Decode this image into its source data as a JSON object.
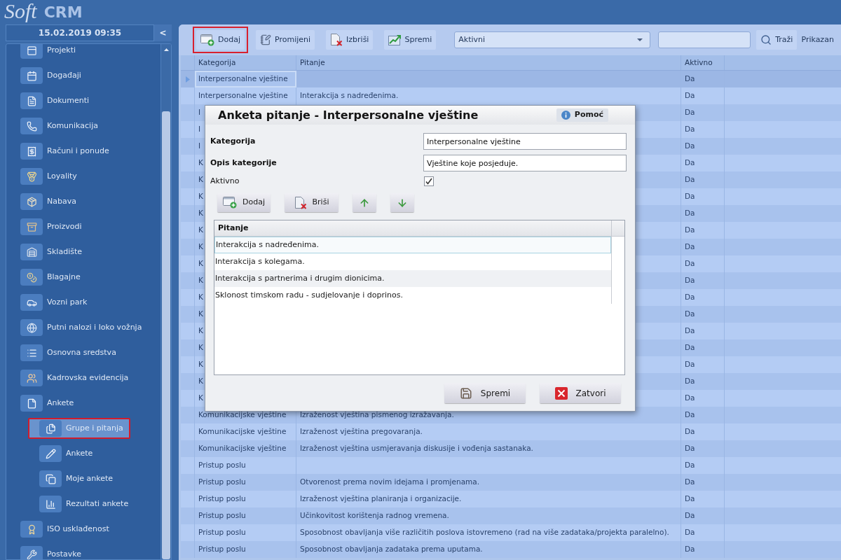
{
  "logo": {
    "script": "Soft",
    "wordmark": "CRM"
  },
  "sidebar": {
    "datetime": "15.02.2019 09:35",
    "collapse_button": "<",
    "items": [
      {
        "label": "Projekti",
        "selected": false,
        "highlighted": false
      },
      {
        "label": "Događaji",
        "selected": false,
        "highlighted": false
      },
      {
        "label": "Dokumenti",
        "selected": false,
        "highlighted": false
      },
      {
        "label": "Komunikacija",
        "selected": false,
        "highlighted": false
      },
      {
        "label": "Računi i ponude",
        "selected": false,
        "highlighted": false
      },
      {
        "label": "Loyality",
        "selected": false,
        "highlighted": false
      },
      {
        "label": "Nabava",
        "selected": false,
        "highlighted": false
      },
      {
        "label": "Proizvodi",
        "selected": false,
        "highlighted": false
      },
      {
        "label": "Skladište",
        "selected": false,
        "highlighted": false
      },
      {
        "label": "Blagajne",
        "selected": false,
        "highlighted": false
      },
      {
        "label": "Vozni park",
        "selected": false,
        "highlighted": false
      },
      {
        "label": "Putni nalozi i loko vožnja",
        "selected": false,
        "highlighted": false
      },
      {
        "label": "Osnovna sredstva",
        "selected": false,
        "highlighted": false
      },
      {
        "label": "Kadrovska evidencija",
        "selected": false,
        "highlighted": false
      },
      {
        "label": "Ankete",
        "selected": false,
        "highlighted": false,
        "children": [
          {
            "label": "Grupe i pitanja",
            "selected": true,
            "highlighted": true
          },
          {
            "label": "Ankete",
            "selected": false,
            "highlighted": false
          },
          {
            "label": "Moje ankete",
            "selected": false,
            "highlighted": false
          },
          {
            "label": "Rezultati ankete",
            "selected": false,
            "highlighted": false
          }
        ]
      },
      {
        "label": "ISO usklađenost",
        "selected": false,
        "highlighted": false
      },
      {
        "label": "Postavke",
        "selected": false,
        "highlighted": false
      }
    ]
  },
  "toolbar": {
    "buttons": [
      {
        "kind": "add",
        "label": "Dodaj",
        "highlighted": true
      },
      {
        "kind": "edit",
        "label": "Promijeni",
        "highlighted": false
      },
      {
        "kind": "delete",
        "label": "Izbriši",
        "highlighted": false
      },
      {
        "kind": "save",
        "label": "Spremi",
        "highlighted": false
      }
    ],
    "status_filter": {
      "value": "Aktivni"
    },
    "search_button": "Traži",
    "display_label": "Prikazan"
  },
  "table": {
    "columns": [
      "Kategorija",
      "Pitanje",
      "Aktivno"
    ],
    "rows": [
      {
        "category": "Interpersonalne vještine",
        "active": "Da",
        "selected": true
      },
      {
        "category": "Interpersonalne vještine",
        "question": "Interakcija s nadređenima.",
        "active": "Da",
        "selected": false
      },
      {
        "category": "I",
        "active": "Da",
        "selected": false
      },
      {
        "category": "I",
        "active": "Da",
        "selected": false
      },
      {
        "category": "I",
        "active": "Da",
        "selected": false
      },
      {
        "category": "K",
        "active": "Da",
        "selected": false
      },
      {
        "category": "K",
        "active": "Da",
        "selected": false
      },
      {
        "category": "K",
        "active": "Da",
        "selected": false
      },
      {
        "category": "K",
        "active": "Da",
        "selected": false
      },
      {
        "category": "K",
        "active": "Da",
        "selected": false
      },
      {
        "category": "K",
        "active": "Da",
        "selected": false
      },
      {
        "category": "K",
        "active": "Da",
        "selected": false
      },
      {
        "category": "K",
        "active": "Da",
        "selected": false
      },
      {
        "category": "K",
        "active": "Da",
        "selected": false
      },
      {
        "category": "K",
        "active": "Da",
        "selected": false
      },
      {
        "category": "K",
        "active": "Da",
        "selected": false
      },
      {
        "category": "K",
        "active": "Da",
        "selected": false
      },
      {
        "category": "K",
        "active": "Da",
        "selected": false
      },
      {
        "category": "K",
        "active": "Da",
        "selected": false
      },
      {
        "category": "K",
        "active": "Da",
        "selected": false
      },
      {
        "category": "Komunikacijske vještine",
        "question": "Izraženost vještina pismenog izražavanja.",
        "active": "Da",
        "selected": false
      },
      {
        "category": "Komunikacijske vještine",
        "question": "Izraženost vještina pregovaranja.",
        "active": "Da",
        "selected": false
      },
      {
        "category": "Komunikacijske vještine",
        "question": "Izraženost vještina usmjeravanja diskusije i vođenja sastanaka.",
        "active": "Da",
        "selected": false
      },
      {
        "category": "Pristup poslu",
        "active": "Da",
        "selected": false
      },
      {
        "category": "Pristup poslu",
        "question": "Otvorenost prema novim idejama i promjenama.",
        "active": "Da",
        "selected": false
      },
      {
        "category": "Pristup poslu",
        "question": "Izraženost vještina planiranja i organizacije.",
        "active": "Da",
        "selected": false
      },
      {
        "category": "Pristup poslu",
        "question": "Učinkovitost korištenja radnog vremena.",
        "active": "Da",
        "selected": false
      },
      {
        "category": "Pristup poslu",
        "question": "Sposobnost obavljanja više različitih poslova istovremeno (rad na više zadataka/projekta paralelno).",
        "active": "Da",
        "selected": false
      },
      {
        "category": "Pristup poslu",
        "question": "Sposobnost obavljanja zadataka prema uputama.",
        "active": "Da",
        "selected": false
      }
    ]
  },
  "dialog": {
    "title": "Anketa pitanje - Interpersonalne vještine",
    "help_button": "Pomoć",
    "fields": [
      {
        "label": "Kategorija",
        "value": "Interpersonalne vještine"
      },
      {
        "label": "Opis kategorije",
        "value": "Vještine koje posjeduje."
      }
    ],
    "active_checkbox": {
      "label": "Aktivno",
      "checked": true
    },
    "list_buttons": [
      {
        "kind": "add",
        "label": "Dodaj"
      },
      {
        "kind": "delete",
        "label": "Briši"
      },
      {
        "kind": "move_up"
      },
      {
        "kind": "move_down"
      }
    ],
    "grid": {
      "header": "Pitanje",
      "rows": [
        {
          "text": "Interakcija s nadređenima.",
          "selected": true
        },
        {
          "text": "Interakcija s kolegama.",
          "selected": false
        },
        {
          "text": "Interakcija s partnerima i drugim dionicima.",
          "selected": false
        },
        {
          "text": "Sklonost timskom radu - sudjelovanje i doprinos.",
          "selected": false
        }
      ]
    },
    "footer_buttons": [
      {
        "kind": "save",
        "label": "Spremi"
      },
      {
        "kind": "close",
        "label": "Zatvori"
      }
    ]
  }
}
